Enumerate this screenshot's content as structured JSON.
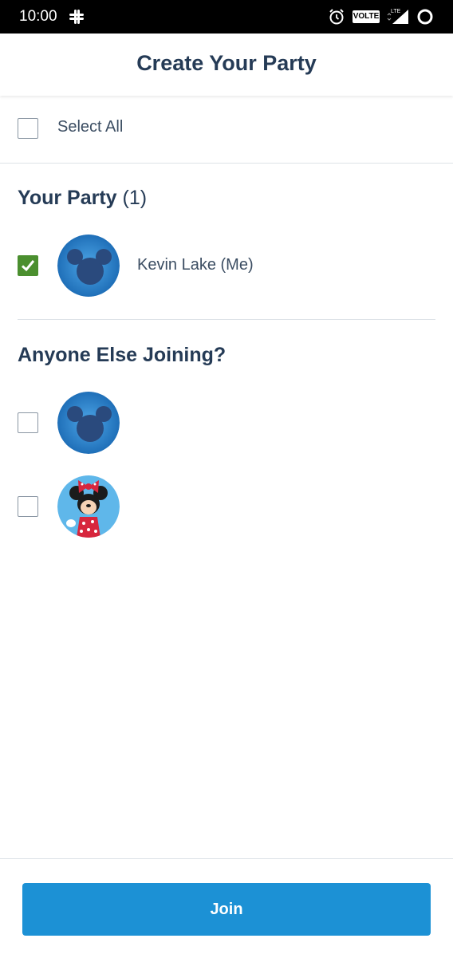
{
  "status_bar": {
    "time": "10:00",
    "volte": "VOLTE",
    "icons": [
      "slack-icon",
      "alarm-icon",
      "lte-signal-icon",
      "circle-icon"
    ]
  },
  "header": {
    "title": "Create Your Party"
  },
  "select_all": {
    "label": "Select All",
    "checked": false
  },
  "your_party": {
    "title": "Your Party",
    "count": "(1)",
    "members": [
      {
        "name": "Kevin Lake (Me)",
        "checked": true,
        "avatar": "mickey-silhouette"
      }
    ]
  },
  "others": {
    "title": "Anyone Else Joining?",
    "members": [
      {
        "name": "",
        "checked": false,
        "avatar": "mickey-silhouette"
      },
      {
        "name": "",
        "checked": false,
        "avatar": "minnie-mouse"
      }
    ]
  },
  "footer": {
    "join_label": "Join"
  },
  "colors": {
    "accent": "#1c91d5",
    "checked": "#4b8f2f",
    "text": "#253b56"
  }
}
